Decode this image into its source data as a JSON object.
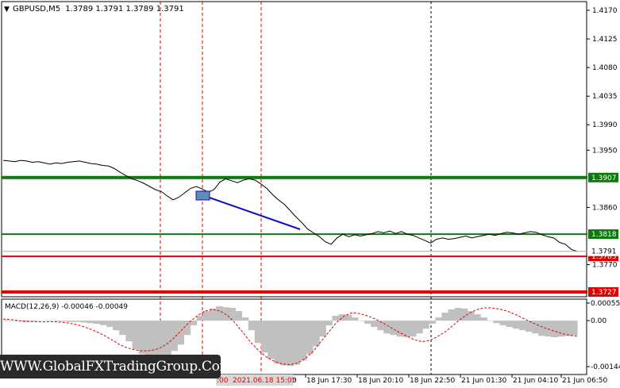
{
  "header": {
    "symbol_timeframe": "GBPUSD,M5",
    "ohlc": "1.3789 1.3791 1.3789 1.3791"
  },
  "price_axis": {
    "ticks": [
      "1.4170",
      "1.4125",
      "1.4080",
      "1.4035",
      "1.3990",
      "1.3950",
      "1.3860",
      "1.3770"
    ],
    "tick_values": [
      1.417,
      1.4125,
      1.408,
      1.4035,
      1.399,
      1.395,
      1.386,
      1.377
    ]
  },
  "levels": [
    {
      "label": "1.3907",
      "value": 1.3907,
      "color": "#0a7a0a"
    },
    {
      "label": "1.3818",
      "value": 1.3818,
      "color": "#0a7a0a"
    },
    {
      "label": "1.3783",
      "value": 1.3783,
      "color": "#e00000"
    },
    {
      "label": "1.3727",
      "value": 1.3727,
      "color": "#e00000"
    }
  ],
  "current_price": {
    "label": "1.3791",
    "value": 1.3791
  },
  "macd": {
    "title": "MACD(12,26,9) -0.00046 -0.00049",
    "ticks": [
      "0.00055",
      "0.00",
      "-0.00144"
    ],
    "tick_values": [
      0.00055,
      0.0,
      -0.00144
    ]
  },
  "time_axis": {
    "ticks": [
      "18 Jun 17:30",
      "18 Jun 20:10",
      "18 Jun 22:50",
      "21 Jun 01:30",
      "21 Jun 04:10",
      "21 Jun 06:50"
    ],
    "crosshair_label": "2021.06.18 15:05",
    "crosshair_left_fragment": ":00"
  },
  "watermark": "WWW.GlobalFXTradingGroup.Com",
  "series_price": [
    1.3934,
    1.3933,
    1.3932,
    1.3934,
    1.3933,
    1.3931,
    1.3932,
    1.393,
    1.3928,
    1.393,
    1.3929,
    1.3931,
    1.3932,
    1.3933,
    1.3931,
    1.3929,
    1.3928,
    1.3926,
    1.3925,
    1.3921,
    1.3915,
    1.391,
    1.3905,
    1.3902,
    1.3898,
    1.3893,
    1.3888,
    1.3885,
    1.3878,
    1.3872,
    1.3876,
    1.3883,
    1.389,
    1.3893,
    1.3889,
    1.3884,
    1.3888,
    1.39,
    1.3905,
    1.3902,
    1.3899,
    1.3903,
    1.3905,
    1.3903,
    1.3897,
    1.389,
    1.388,
    1.3872,
    1.3865,
    1.3855,
    1.3845,
    1.3836,
    1.3826,
    1.382,
    1.3814,
    1.3806,
    1.3802,
    1.3812,
    1.3818,
    1.3814,
    1.3817,
    1.3815,
    1.3817,
    1.3819,
    1.3822,
    1.382,
    1.3823,
    1.3819,
    1.3822,
    1.3818,
    1.3816,
    1.3812,
    1.3808,
    1.3804,
    1.381,
    1.3812,
    1.381,
    1.3811,
    1.3813,
    1.3815,
    1.3812,
    1.3814,
    1.3816,
    1.3818,
    1.3816,
    1.3819,
    1.3821,
    1.382,
    1.3818,
    1.382,
    1.3822,
    1.3821,
    1.3817,
    1.3814,
    1.3812,
    1.3805,
    1.3802,
    1.3794,
    1.3791
  ],
  "series_macd_hist": [
    0.0,
    0.0,
    -2e-05,
    -5e-05,
    -3e-05,
    -1e-05,
    1e-05,
    0.0,
    -2e-05,
    -3e-05,
    -4e-05,
    -4e-05,
    -6e-05,
    -8e-05,
    -0.0001,
    -0.00014,
    -0.0002,
    -0.0003,
    -0.00045,
    -0.00065,
    -0.0009,
    -0.00105,
    -0.00115,
    -0.0012,
    -0.00118,
    -0.0011,
    -0.00095,
    -0.00075,
    -0.00045,
    -0.00015,
    0.00015,
    0.0003,
    0.00038,
    0.00045,
    0.00042,
    0.0004,
    0.0003,
    0.0001,
    -0.0003,
    -0.0007,
    -0.001,
    -0.0012,
    -0.00135,
    -0.0014,
    -0.00142,
    -0.00138,
    -0.00125,
    -0.00105,
    -0.0008,
    -0.0005,
    -0.00015,
    0.00015,
    0.0002,
    0.00018,
    0.0001,
    0.0,
    -0.0001,
    -0.0002,
    -0.0003,
    -0.0004,
    -0.00045,
    -0.0005,
    -0.00052,
    -0.0005,
    -0.0004,
    -0.00025,
    -0.0001,
    0.0001,
    0.00025,
    0.00035,
    0.0004,
    0.00038,
    0.0003,
    0.0002,
    0.0001,
    0.0,
    -8e-05,
    -0.00015,
    -0.0002,
    -0.00025,
    -0.0003,
    -0.00035,
    -0.0004,
    -0.00048,
    -0.0005,
    -0.00052,
    -0.0005,
    -0.00048,
    -0.00046
  ],
  "series_macd_signal": [
    5e-05,
    3e-05,
    0.0,
    -2e-05,
    -3e-05,
    -4e-05,
    -3e-05,
    -4e-05,
    -6e-05,
    -0.0001,
    -0.00016,
    -0.00024,
    -0.00034,
    -0.00046,
    -0.0006,
    -0.00075,
    -0.00085,
    -0.00092,
    -0.00095,
    -0.00094,
    -0.00088,
    -0.00075,
    -0.00055,
    -0.0003,
    -5e-05,
    0.00015,
    0.0003,
    0.00035,
    0.0003,
    0.00015,
    -0.0001,
    -0.0004,
    -0.0007,
    -0.00095,
    -0.00115,
    -0.00128,
    -0.00136,
    -0.00138,
    -0.00132,
    -0.00118,
    -0.00095,
    -0.00065,
    -0.00035,
    -5e-05,
    0.00015,
    0.00025,
    0.00022,
    0.00015,
    5e-05,
    -8e-05,
    -0.00022,
    -0.00036,
    -0.00048,
    -0.0006,
    -0.00066,
    -0.00062,
    -0.0005,
    -0.00035,
    -0.00015,
    5e-05,
    0.00022,
    0.00034,
    0.0004,
    0.0004,
    0.00036,
    0.0003,
    0.0002,
    8e-05,
    -4e-05,
    -0.00015,
    -0.00024,
    -0.00032,
    -0.0004,
    -0.00046,
    -0.00049
  ]
}
